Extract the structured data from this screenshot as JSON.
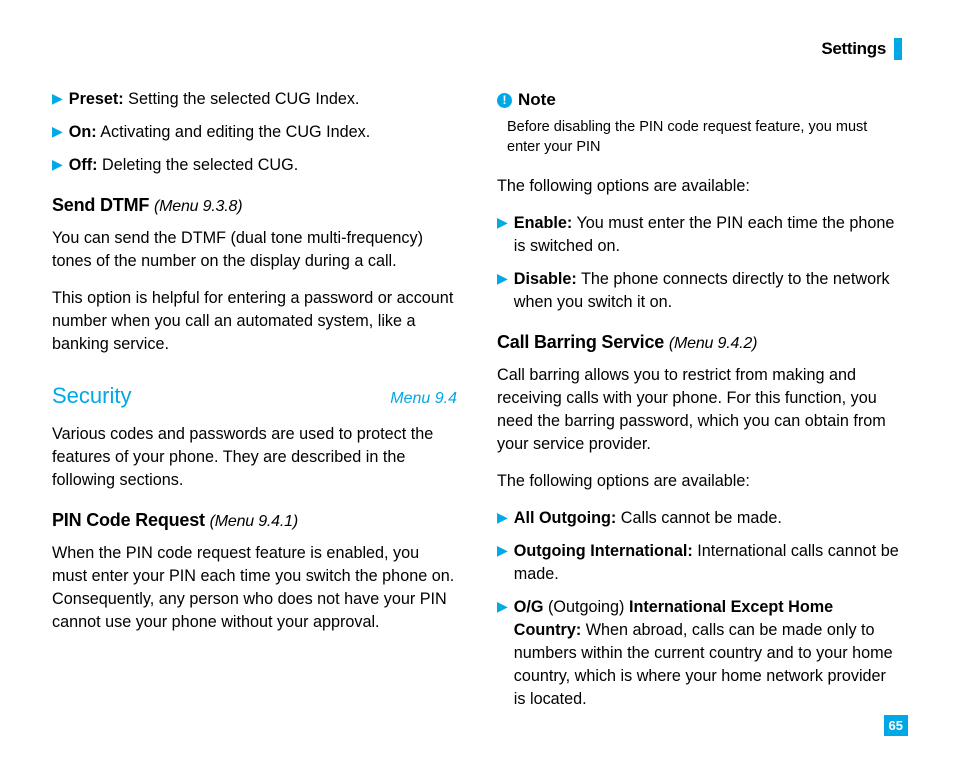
{
  "header": {
    "title": "Settings"
  },
  "left": {
    "bullets_top": [
      {
        "label": "Preset:",
        "text": " Setting the selected CUG Index."
      },
      {
        "label": "On:",
        "text": " Activating and editing the CUG Index."
      },
      {
        "label": "Off:",
        "text": " Deleting the selected CUG."
      }
    ],
    "send_dtmf": {
      "title": "Send DTMF",
      "menu": "(Menu 9.3.8)",
      "p1": "You can send the DTMF (dual tone multi-frequency) tones of the number on the display during a call.",
      "p2": "This option is helpful for entering a password or account number when you call an automated system, like a banking service."
    },
    "security": {
      "title": "Security",
      "menu": "Menu 9.4",
      "p1": "Various codes and passwords are used to protect the features of your phone. They are described in the following sections."
    },
    "pin": {
      "title": "PIN Code Request",
      "menu": "(Menu 9.4.1)",
      "p1": "When the PIN code request feature is enabled, you must enter your PIN each time you switch the phone on. Consequently, any person who does not have your PIN cannot use your phone without your approval."
    }
  },
  "right": {
    "note": {
      "title": "Note",
      "body": "Before disabling the PIN code request feature, you must enter your PIN"
    },
    "options_intro1": "The following options are available:",
    "pin_options": [
      {
        "label": "Enable:",
        "text": " You must enter the PIN each time the phone is switched on."
      },
      {
        "label": "Disable:",
        "text": " The phone connects directly to the network when you switch it on."
      }
    ],
    "call_barring": {
      "title": "Call Barring Service",
      "menu": "(Menu 9.4.2)",
      "p1": "Call barring allows you to restrict from making and receiving calls with your phone. For this function, you need the barring password, which you can obtain from your service provider."
    },
    "options_intro2": "The following options are available:",
    "barring_options": {
      "opt1": {
        "label": "All Outgoing:",
        "text": " Calls cannot be made."
      },
      "opt2": {
        "label": "Outgoing International:",
        "text": " International calls cannot be made."
      },
      "opt3": {
        "label1": "O/G",
        "mid": " (Outgoing) ",
        "label2": "International Except Home Country:",
        "text": " When abroad, calls can be made only to numbers within the current country and to your home country, which is where your home network provider is located."
      }
    }
  },
  "page": "65"
}
